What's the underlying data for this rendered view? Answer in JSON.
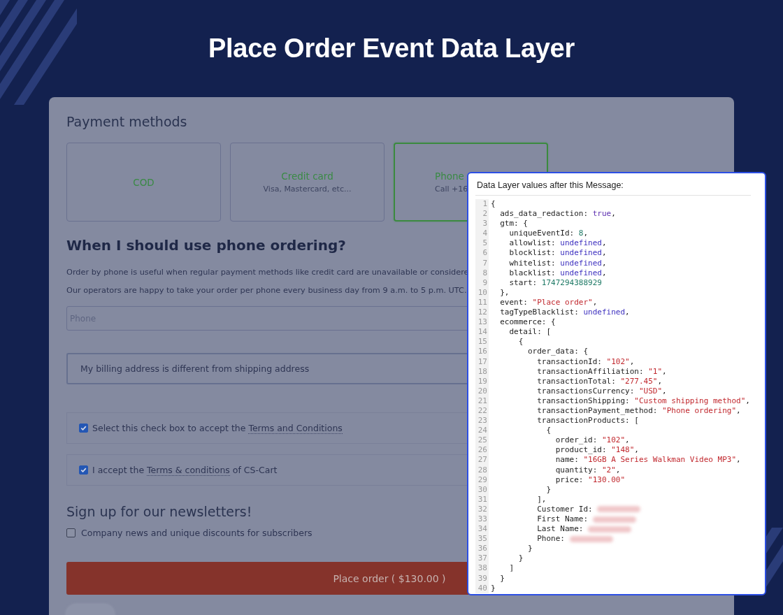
{
  "title": "Place Order Event Data Layer",
  "payment": {
    "heading": "Payment methods",
    "methods": [
      {
        "name": "COD",
        "selected": false
      },
      {
        "name": "Credit card",
        "description": "Visa, Mastercard, etc...",
        "selected": false
      },
      {
        "name": "Phone",
        "description": "Call +16",
        "selected": true
      }
    ]
  },
  "info": {
    "heading": "When I should use phone ordering?",
    "paragraphs": [
      "Order by phone is useful when regular payment methods like credit card are unavailable or considere",
      "Our operators are happy to take your order per phone every business day from 9 a.m. to 5 p.m. UTC."
    ]
  },
  "phone_field": {
    "placeholder": "Phone"
  },
  "billing_option": {
    "label": "My billing address is different from shipping address"
  },
  "agreements": [
    {
      "before": "Select this check box to accept the ",
      "link": "Terms and Conditions",
      "checked": true
    },
    {
      "before": "I accept the ",
      "link": "Terms & conditions",
      "after": " of CS-Cart",
      "checked": true
    }
  ],
  "newsletter": {
    "heading": "Sign up for our newsletters!",
    "options": [
      {
        "label": "Company news and unique discounts for subscribers",
        "checked": false
      }
    ]
  },
  "place_order_button": "Place order ( $130.00 )",
  "data_layer": {
    "title": "Data Layer values after this Message:",
    "lines": [
      {
        "n": "1",
        "tokens": [
          {
            "kind": "plain",
            "text": "{"
          }
        ]
      },
      {
        "n": "2",
        "tokens": [
          {
            "kind": "plain",
            "text": "  ads_data_redaction: "
          },
          {
            "kind": "boolean",
            "text": "true"
          },
          {
            "kind": "plain",
            "text": ","
          }
        ]
      },
      {
        "n": "3",
        "tokens": [
          {
            "kind": "plain",
            "text": "  gtm: {"
          }
        ]
      },
      {
        "n": "4",
        "tokens": [
          {
            "kind": "plain",
            "text": "    uniqueEventId: "
          },
          {
            "kind": "number",
            "text": "8"
          },
          {
            "kind": "plain",
            "text": ","
          }
        ]
      },
      {
        "n": "5",
        "tokens": [
          {
            "kind": "plain",
            "text": "    allowlist: "
          },
          {
            "kind": "undefined",
            "text": "undefined"
          },
          {
            "kind": "plain",
            "text": ","
          }
        ]
      },
      {
        "n": "6",
        "tokens": [
          {
            "kind": "plain",
            "text": "    blocklist: "
          },
          {
            "kind": "undefined",
            "text": "undefined"
          },
          {
            "kind": "plain",
            "text": ","
          }
        ]
      },
      {
        "n": "7",
        "tokens": [
          {
            "kind": "plain",
            "text": "    whitelist: "
          },
          {
            "kind": "undefined",
            "text": "undefined"
          },
          {
            "kind": "plain",
            "text": ","
          }
        ]
      },
      {
        "n": "8",
        "tokens": [
          {
            "kind": "plain",
            "text": "    blacklist: "
          },
          {
            "kind": "undefined",
            "text": "undefined"
          },
          {
            "kind": "plain",
            "text": ","
          }
        ]
      },
      {
        "n": "9",
        "tokens": [
          {
            "kind": "plain",
            "text": "    start: "
          },
          {
            "kind": "number",
            "text": "1747294388929"
          }
        ]
      },
      {
        "n": "10",
        "tokens": [
          {
            "kind": "plain",
            "text": "  },"
          }
        ]
      },
      {
        "n": "11",
        "tokens": [
          {
            "kind": "plain",
            "text": "  event: "
          },
          {
            "kind": "string",
            "text": "\"Place order\""
          },
          {
            "kind": "plain",
            "text": ","
          }
        ]
      },
      {
        "n": "12",
        "tokens": [
          {
            "kind": "plain",
            "text": "  tagTypeBlacklist: "
          },
          {
            "kind": "undefined",
            "text": "undefined"
          },
          {
            "kind": "plain",
            "text": ","
          }
        ]
      },
      {
        "n": "13",
        "tokens": [
          {
            "kind": "plain",
            "text": "  ecommerce: {"
          }
        ]
      },
      {
        "n": "14",
        "tokens": [
          {
            "kind": "plain",
            "text": "    detail: ["
          }
        ]
      },
      {
        "n": "15",
        "tokens": [
          {
            "kind": "plain",
            "text": "      {"
          }
        ]
      },
      {
        "n": "16",
        "tokens": [
          {
            "kind": "plain",
            "text": "        order_data: {"
          }
        ]
      },
      {
        "n": "17",
        "tokens": [
          {
            "kind": "plain",
            "text": "          transactionId: "
          },
          {
            "kind": "string",
            "text": "\"102\""
          },
          {
            "kind": "plain",
            "text": ","
          }
        ]
      },
      {
        "n": "18",
        "tokens": [
          {
            "kind": "plain",
            "text": "          transactionAffiliation: "
          },
          {
            "kind": "string",
            "text": "\"1\""
          },
          {
            "kind": "plain",
            "text": ","
          }
        ]
      },
      {
        "n": "19",
        "tokens": [
          {
            "kind": "plain",
            "text": "          transactionTotal: "
          },
          {
            "kind": "string",
            "text": "\"277.45\""
          },
          {
            "kind": "plain",
            "text": ","
          }
        ]
      },
      {
        "n": "20",
        "tokens": [
          {
            "kind": "plain",
            "text": "          transactionsCurrency: "
          },
          {
            "kind": "string",
            "text": "\"USD\""
          },
          {
            "kind": "plain",
            "text": ","
          }
        ]
      },
      {
        "n": "21",
        "tokens": [
          {
            "kind": "plain",
            "text": "          transactionShipping: "
          },
          {
            "kind": "string",
            "text": "\"Custom shipping method\""
          },
          {
            "kind": "plain",
            "text": ","
          }
        ]
      },
      {
        "n": "22",
        "tokens": [
          {
            "kind": "plain",
            "text": "          transactionPayment_method: "
          },
          {
            "kind": "string",
            "text": "\"Phone ordering\""
          },
          {
            "kind": "plain",
            "text": ","
          }
        ]
      },
      {
        "n": "23",
        "tokens": [
          {
            "kind": "plain",
            "text": "          transactionProducts: ["
          }
        ]
      },
      {
        "n": "24",
        "tokens": [
          {
            "kind": "plain",
            "text": "            {"
          }
        ]
      },
      {
        "n": "25",
        "tokens": [
          {
            "kind": "plain",
            "text": "              order_id: "
          },
          {
            "kind": "string",
            "text": "\"102\""
          },
          {
            "kind": "plain",
            "text": ","
          }
        ]
      },
      {
        "n": "26",
        "tokens": [
          {
            "kind": "plain",
            "text": "              product_id: "
          },
          {
            "kind": "string",
            "text": "\"148\""
          },
          {
            "kind": "plain",
            "text": ","
          }
        ]
      },
      {
        "n": "27",
        "tokens": [
          {
            "kind": "plain",
            "text": "              name: "
          },
          {
            "kind": "string",
            "text": "\"16GB A Series Walkman Video MP3\""
          },
          {
            "kind": "plain",
            "text": ","
          }
        ]
      },
      {
        "n": "28",
        "tokens": [
          {
            "kind": "plain",
            "text": "              quantity: "
          },
          {
            "kind": "string",
            "text": "\"2\""
          },
          {
            "kind": "plain",
            "text": ","
          }
        ]
      },
      {
        "n": "29",
        "tokens": [
          {
            "kind": "plain",
            "text": "              price: "
          },
          {
            "kind": "string",
            "text": "\"130.00\""
          }
        ]
      },
      {
        "n": "30",
        "tokens": [
          {
            "kind": "plain",
            "text": "            }"
          }
        ]
      },
      {
        "n": "31",
        "tokens": [
          {
            "kind": "plain",
            "text": "          ],"
          }
        ]
      },
      {
        "n": "32",
        "tokens": [
          {
            "kind": "plain",
            "text": "          Customer Id: "
          }
        ],
        "redacted": true
      },
      {
        "n": "33",
        "tokens": [
          {
            "kind": "plain",
            "text": "          First Name: "
          }
        ],
        "redacted": true
      },
      {
        "n": "34",
        "tokens": [
          {
            "kind": "plain",
            "text": "          Last Name: "
          }
        ],
        "redacted": true
      },
      {
        "n": "35",
        "tokens": [
          {
            "kind": "plain",
            "text": "          Phone: "
          }
        ],
        "redacted": true
      },
      {
        "n": "36",
        "tokens": [
          {
            "kind": "plain",
            "text": "        }"
          }
        ]
      },
      {
        "n": "37",
        "tokens": [
          {
            "kind": "plain",
            "text": "      }"
          }
        ]
      },
      {
        "n": "38",
        "tokens": [
          {
            "kind": "plain",
            "text": "    ]"
          }
        ]
      },
      {
        "n": "39",
        "tokens": [
          {
            "kind": "plain",
            "text": "  }"
          }
        ]
      },
      {
        "n": "40",
        "tokens": [
          {
            "kind": "plain",
            "text": "}"
          }
        ]
      }
    ]
  }
}
